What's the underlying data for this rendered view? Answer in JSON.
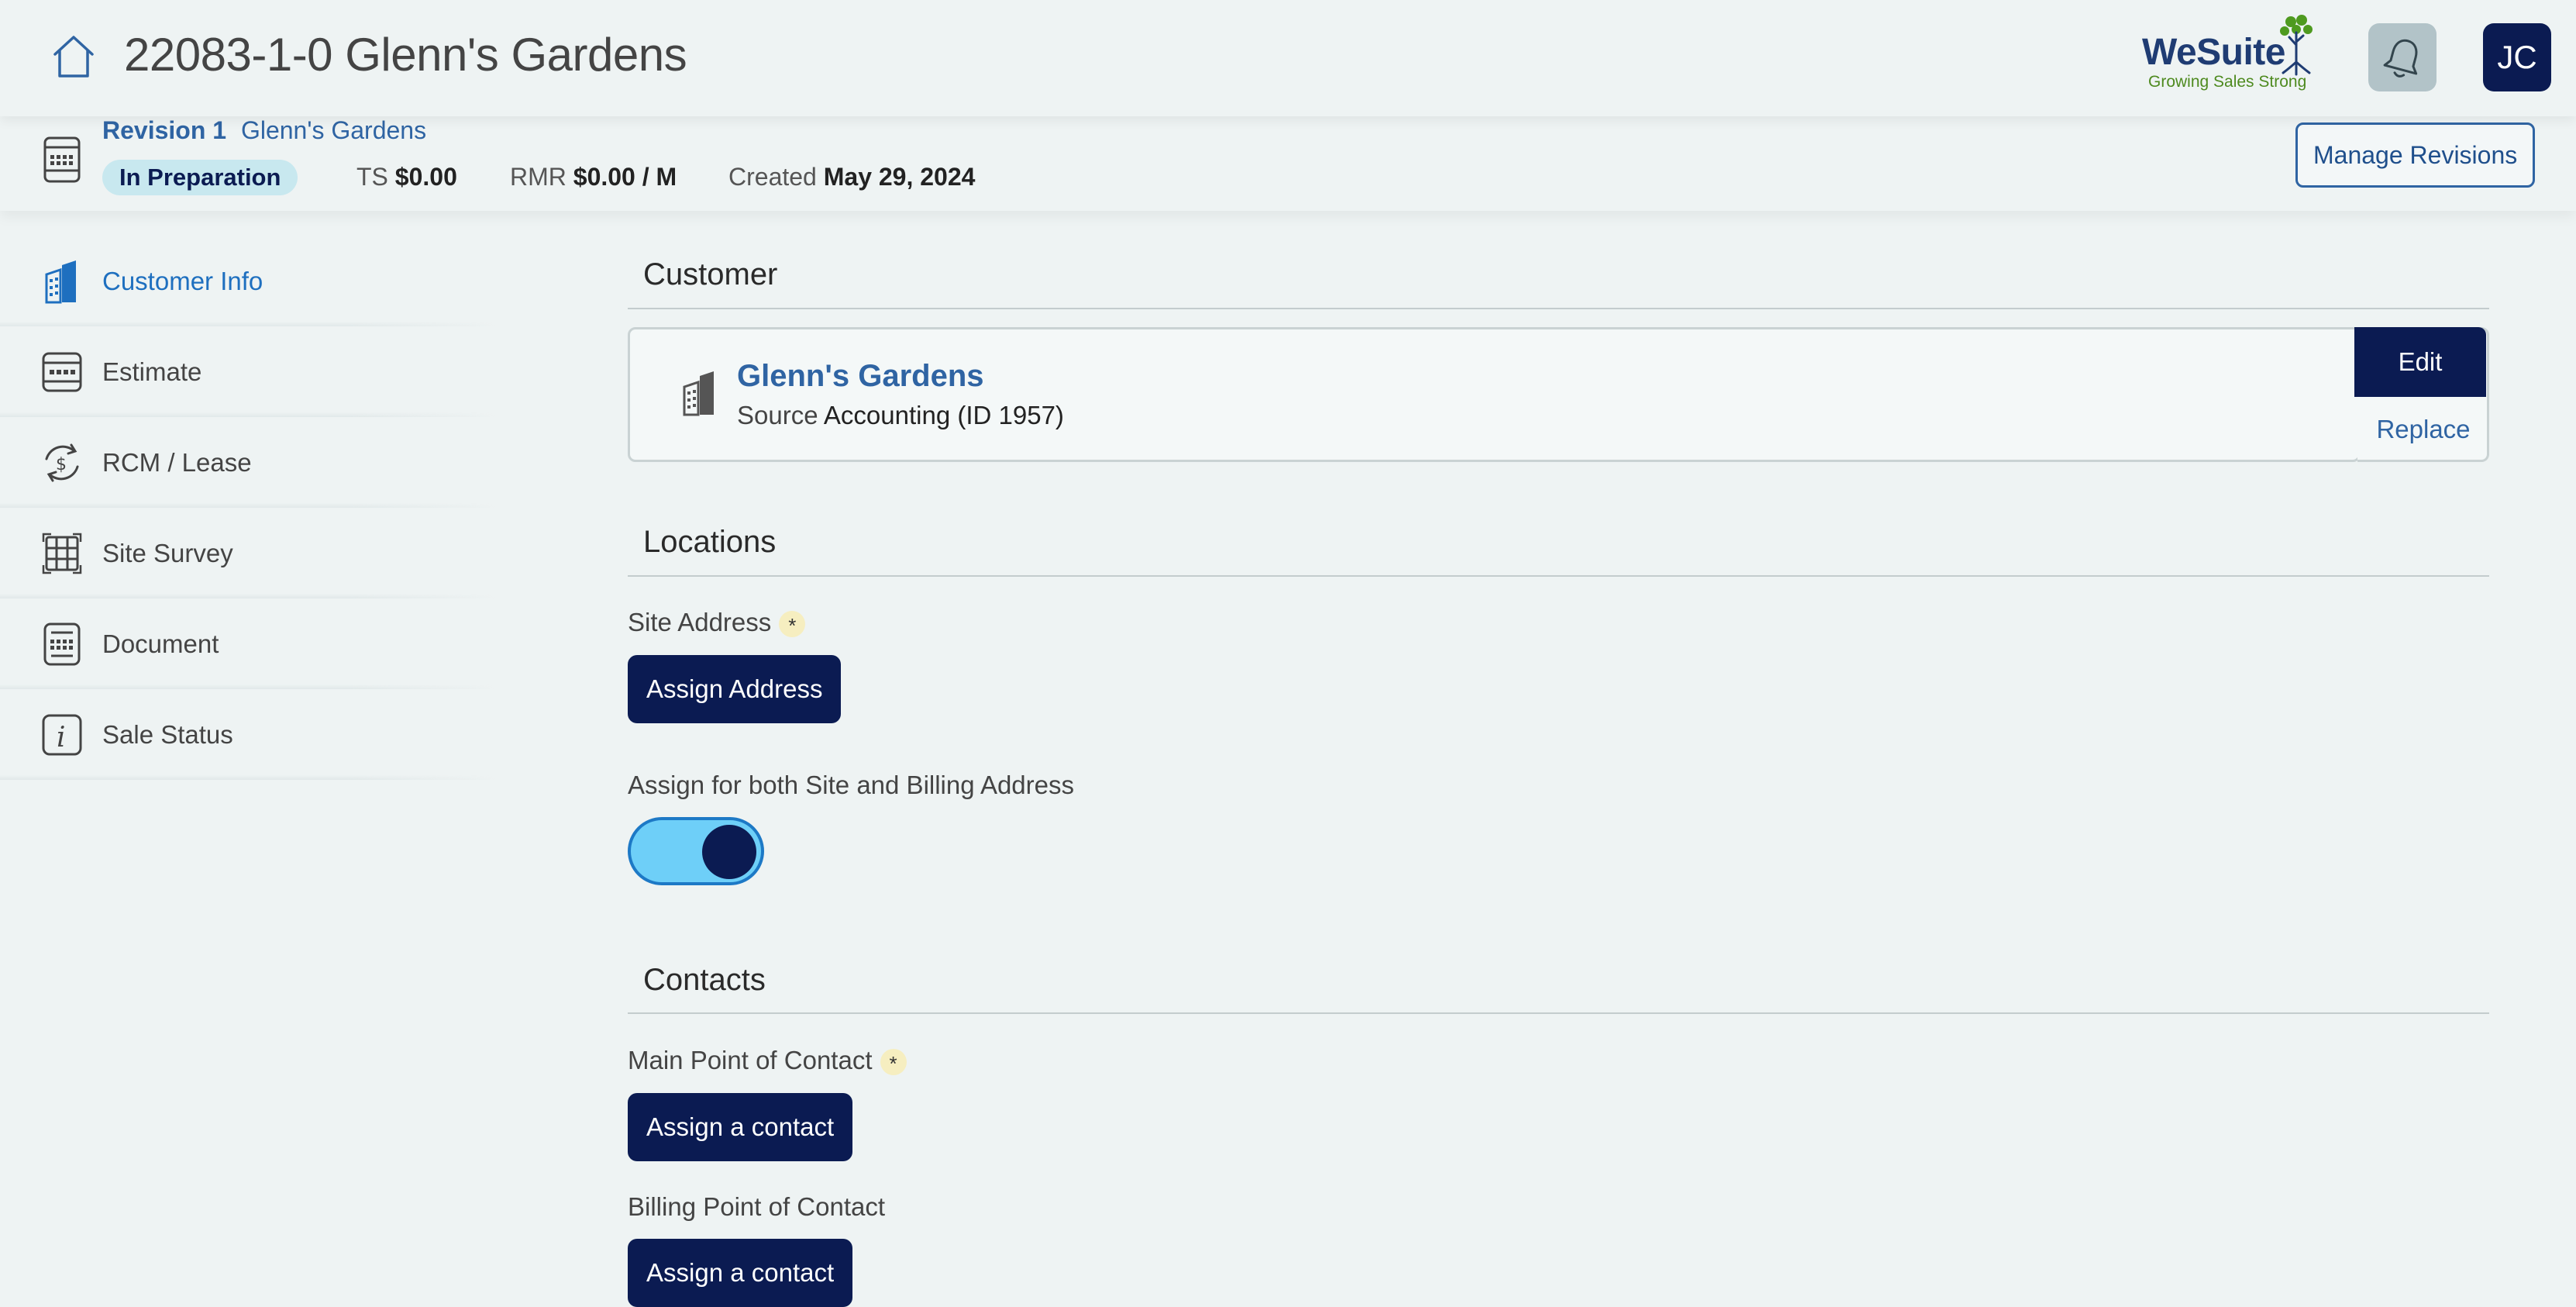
{
  "header": {
    "title": "22083-1-0 Glenn's Gardens",
    "logo_word": "WeSuite",
    "logo_tagline": "Growing Sales Strong",
    "avatar_initials": "JC",
    "icons": {
      "home": "home-icon",
      "notifications": "bell-icon"
    }
  },
  "revision": {
    "label": "Revision 1",
    "name": "Glenn's Gardens",
    "status": "In Preparation",
    "ts_label": "TS",
    "ts_value": "$0.00",
    "rmr_label": "RMR",
    "rmr_value": "$0.00 / M",
    "created_label": "Created",
    "created_value": "May 29, 2024",
    "manage_button": "Manage Revisions"
  },
  "sidebar": {
    "items": [
      {
        "label": "Customer Info",
        "icon": "building-icon",
        "active": true
      },
      {
        "label": "Estimate",
        "icon": "estimate-icon",
        "active": false
      },
      {
        "label": "RCM / Lease",
        "icon": "dollar-cycle-icon",
        "active": false
      },
      {
        "label": "Site Survey",
        "icon": "grid-icon",
        "active": false
      },
      {
        "label": "Document",
        "icon": "document-icon",
        "active": false
      },
      {
        "label": "Sale Status",
        "icon": "info-icon",
        "active": false
      }
    ]
  },
  "customer": {
    "section_title": "Customer",
    "name": "Glenn's Gardens",
    "source_label": "Source",
    "source_value": "Accounting (ID 1957)",
    "edit_button": "Edit",
    "replace_button": "Replace"
  },
  "locations": {
    "section_title": "Locations",
    "site_address_label": "Site Address",
    "required_mark": "*",
    "assign_address_button": "Assign Address",
    "both_addresses_label": "Assign for both Site and Billing Address",
    "both_addresses_enabled": true
  },
  "contacts": {
    "section_title": "Contacts",
    "main_contact_label": "Main Point of Contact",
    "required_mark": "*",
    "main_contact_button": "Assign a contact",
    "billing_contact_label": "Billing Point of Contact",
    "billing_contact_button": "Assign a contact"
  },
  "colors": {
    "navy": "#0b1b52",
    "link_blue": "#2f64a3",
    "active_blue": "#1e6fbf",
    "status_pill": "#c8e8ef",
    "toggle_on": "#6ecff8",
    "background": "#eef3f3"
  }
}
